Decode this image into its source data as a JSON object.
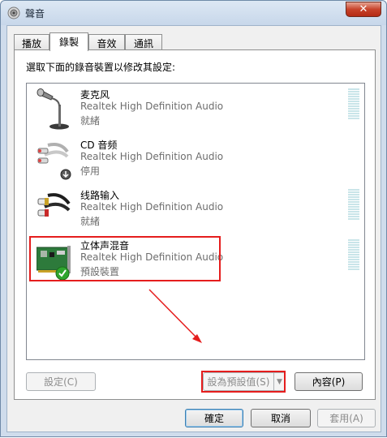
{
  "window": {
    "title": "聲音"
  },
  "tabs": [
    {
      "label": "播放"
    },
    {
      "label": "錄製"
    },
    {
      "label": "音效"
    },
    {
      "label": "通訊"
    }
  ],
  "instruction": "選取下面的錄音裝置以修改其設定:",
  "devices": [
    {
      "name": "麦克风",
      "description": "Realtek High Definition Audio",
      "status": "就緒",
      "icon": "microphone-icon"
    },
    {
      "name": "CD 音频",
      "description": "Realtek High Definition Audio",
      "status": "停用",
      "icon": "rca-cable-icon"
    },
    {
      "name": "线路输入",
      "description": "Realtek High Definition Audio",
      "status": "就緒",
      "icon": "rca-cable-icon"
    },
    {
      "name": "立体声混音",
      "description": "Realtek High Definition Audio",
      "status": "預設裝置",
      "icon": "sound-card-icon"
    }
  ],
  "buttons": {
    "configure": "設定(C)",
    "set_default": "設為預設值(S)",
    "properties": "內容(P)",
    "ok": "確定",
    "cancel": "取消",
    "apply": "套用(A)"
  },
  "close_glyph": "✕",
  "colors": {
    "annotation_red": "#e51d1d",
    "default_check": "#2ea52e"
  }
}
